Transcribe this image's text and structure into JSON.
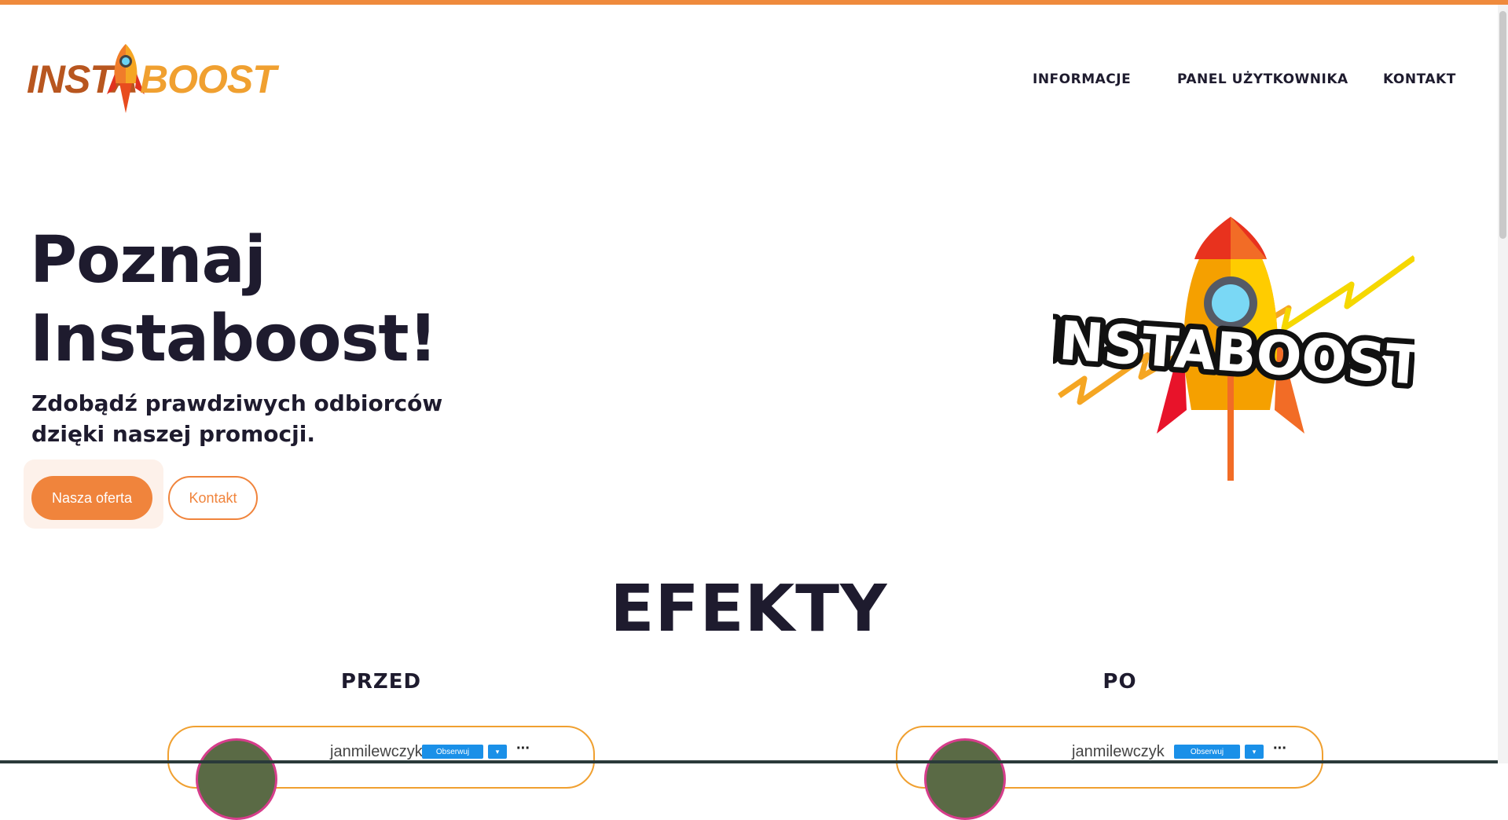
{
  "colors": {
    "accent": "#f0843c",
    "dark": "#1e1b2e",
    "top_bar": "#ef8a3c",
    "follow_blue": "#1a90e8"
  },
  "logo": {
    "part1": "INSTA",
    "part2": "BOOST",
    "icon": "rocket-icon"
  },
  "nav": {
    "items": [
      "INFORMACJE",
      "PANEL UŻYTKOWNIKA",
      "KONTAKT"
    ]
  },
  "hero": {
    "title_line1": "Poznaj",
    "title_line2": "Instaboost!",
    "subtitle_line1": "Zdobądź prawdziwych odbiorców",
    "subtitle_line2": "dzięki naszej promocji.",
    "primary_button": "Nasza oferta",
    "secondary_button": "Kontakt",
    "art_text": "INSTABOOST"
  },
  "effects": {
    "title": "EFEKTY",
    "before_label": "PRZED",
    "after_label": "PO",
    "before_card": {
      "username": "janmilewczyk",
      "follow": "Obserwuj",
      "dropdown": "▾",
      "more": "···"
    },
    "after_card": {
      "username": "janmilewczyk",
      "follow": "Obserwuj",
      "dropdown": "▾",
      "more": "···"
    }
  }
}
